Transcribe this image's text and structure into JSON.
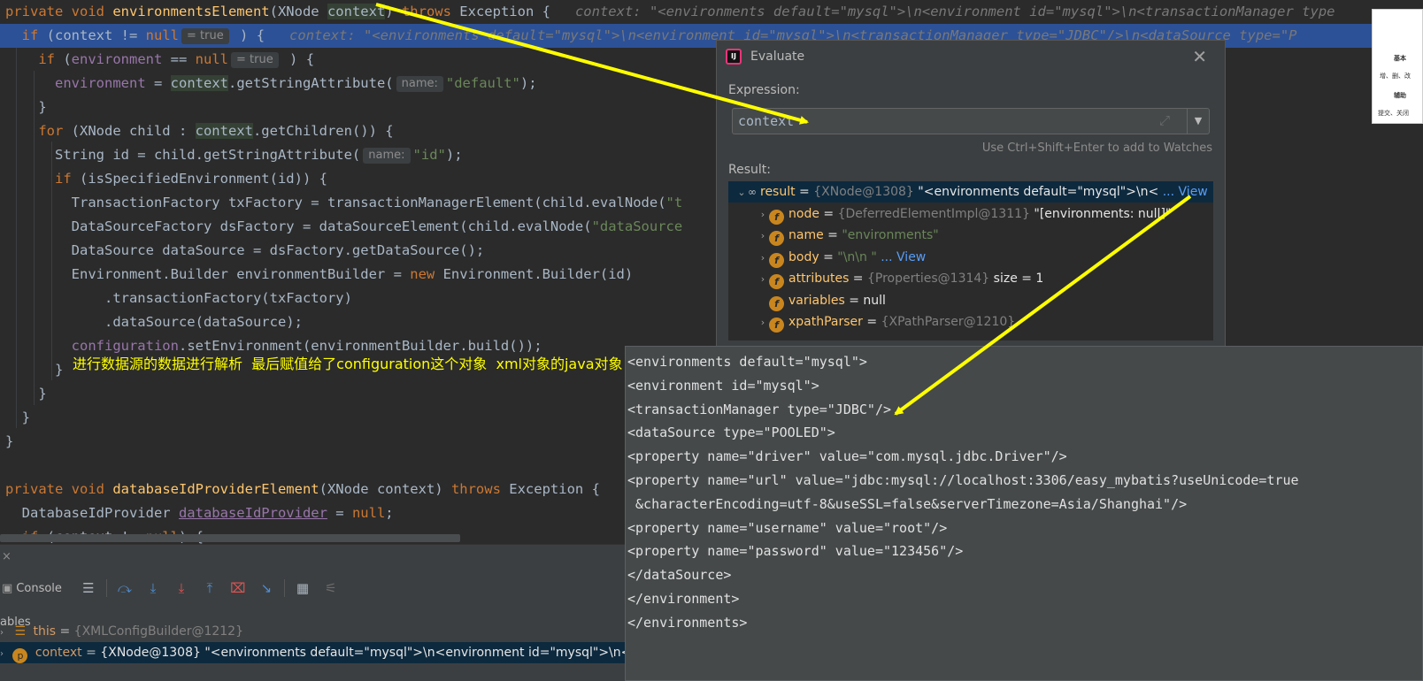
{
  "editor": {
    "lines": [
      {
        "segments": [
          [
            "kw",
            "private void "
          ],
          [
            "fn",
            "environmentsElement"
          ],
          [
            "",
            "(XNode "
          ],
          [
            "ctx",
            "context"
          ],
          [
            "",
            ") "
          ],
          [
            "kw",
            "throws "
          ],
          [
            "",
            "Exception {   "
          ],
          [
            "inline",
            "context: \"<environments default=\"mysql\">\\n<environment id=\"mysql\">\\n<transactionManager type"
          ]
        ]
      },
      {
        "segments": [
          [
            "",
            "  "
          ],
          [
            "kw",
            "if "
          ],
          [
            "",
            "(context != "
          ],
          [
            "kw",
            "null"
          ],
          [
            "hint",
            "= true"
          ],
          [
            "",
            " ) {   "
          ],
          [
            "inline",
            "context: \"<environments default=\"mysql\">\\n<environment id=\"mysql\">\\n<transactionManager type=\"JDBC\"/>\\n<dataSource type=\"P"
          ]
        ]
      },
      {
        "segments": [
          [
            "",
            "    "
          ],
          [
            "kw",
            "if "
          ],
          [
            "",
            "("
          ],
          [
            "fld",
            "environment"
          ],
          [
            "",
            " == "
          ],
          [
            "kw",
            "null"
          ],
          [
            "hint",
            "= true"
          ],
          [
            "",
            " ) {"
          ]
        ]
      },
      {
        "segments": [
          [
            "",
            "      "
          ],
          [
            "fld",
            "environment"
          ],
          [
            "",
            " = "
          ],
          [
            "ctx",
            "context"
          ],
          [
            "",
            ".getStringAttribute("
          ],
          [
            "hint",
            "name:"
          ],
          [
            "str",
            "\"default\""
          ],
          [
            "",
            ");"
          ]
        ]
      },
      {
        "segments": [
          [
            "",
            "    }"
          ]
        ]
      },
      {
        "segments": [
          [
            "",
            "    "
          ],
          [
            "kw",
            "for "
          ],
          [
            "",
            "(XNode child : "
          ],
          [
            "ctx",
            "context"
          ],
          [
            "",
            ".getChildren()) {"
          ]
        ]
      },
      {
        "segments": [
          [
            "",
            "      String id = child.getStringAttribute("
          ],
          [
            "hint",
            "name:"
          ],
          [
            "str",
            "\"id\""
          ],
          [
            "",
            ");"
          ]
        ]
      },
      {
        "segments": [
          [
            "",
            "      "
          ],
          [
            "kw",
            "if "
          ],
          [
            "",
            "(isSpecifiedEnvironment(id)) {"
          ]
        ]
      },
      {
        "segments": [
          [
            "",
            "        TransactionFactory txFactory = transactionManagerElement(child.evalNode("
          ],
          [
            "str",
            "\"t"
          ]
        ]
      },
      {
        "segments": [
          [
            "",
            "        DataSourceFactory dsFactory = dataSourceElement(child.evalNode("
          ],
          [
            "str",
            "\"dataSource"
          ]
        ]
      },
      {
        "segments": [
          [
            "",
            "        DataSource dataSource = dsFactory.getDataSource();"
          ]
        ]
      },
      {
        "segments": [
          [
            "",
            "        Environment.Builder environmentBuilder = "
          ],
          [
            "kw",
            "new "
          ],
          [
            "",
            "Environment.Builder(id)"
          ]
        ]
      },
      {
        "segments": [
          [
            "",
            "            .transactionFactory(txFactory)"
          ]
        ]
      },
      {
        "segments": [
          [
            "",
            "            .dataSource(dataSource);"
          ]
        ]
      },
      {
        "segments": [
          [
            "",
            "        "
          ],
          [
            "fld",
            "configuration"
          ],
          [
            "",
            ".setEnvironment(environmentBuilder.build());"
          ]
        ]
      },
      {
        "segments": [
          [
            "",
            "      }"
          ]
        ]
      },
      {
        "segments": [
          [
            "",
            "    }"
          ]
        ]
      },
      {
        "segments": [
          [
            "",
            "  }"
          ]
        ]
      },
      {
        "segments": [
          [
            "",
            "}"
          ]
        ]
      },
      {
        "segments": [
          [
            "",
            ""
          ]
        ]
      },
      {
        "segments": [
          [
            "kw",
            "private void "
          ],
          [
            "fn",
            "databaseIdProviderElement"
          ],
          [
            "",
            "(XNode context) "
          ],
          [
            "kw",
            "throws "
          ],
          [
            "",
            "Exception {"
          ]
        ]
      },
      {
        "segments": [
          [
            "",
            "  DatabaseIdProvider "
          ],
          [
            "ulfld",
            "databaseIdProvider"
          ],
          [
            "",
            " = "
          ],
          [
            "kw",
            "null"
          ],
          [
            "",
            ";"
          ]
        ]
      },
      {
        "segments": [
          [
            "",
            "  "
          ],
          [
            "kw",
            "if "
          ],
          [
            "",
            "(context != "
          ],
          [
            "kw",
            "null"
          ],
          [
            "",
            ") {"
          ]
        ]
      }
    ]
  },
  "annotation": "进行数据源的数据进行解析  最后赋值给了configuration这个对象  xml对象的java对象",
  "evaluate": {
    "title": "Evaluate",
    "expression_label": "Expression:",
    "expression_value": "context",
    "hint": "Use Ctrl+Shift+Enter to add to Watches",
    "result_label": "Result:",
    "tree": [
      {
        "arrow": "⌄",
        "icon": "glasses",
        "name": "result",
        "type": "{XNode@1308}",
        "value": "\"<environments default=\"mysql\">\\n<",
        "link": "... View",
        "selected": true
      },
      {
        "arrow": "›",
        "icon": "f",
        "name": "node",
        "type": "{DeferredElementImpl@1311}",
        "value": "\"[environments: null]\"",
        "link": ""
      },
      {
        "arrow": "›",
        "icon": "f",
        "name": "name",
        "type": "",
        "value": "\"environments\"",
        "link": ""
      },
      {
        "arrow": "›",
        "icon": "f",
        "name": "body",
        "type": "",
        "value": "\"\\n\\n       \"",
        "link": "... View"
      },
      {
        "arrow": "›",
        "icon": "f",
        "name": "attributes",
        "type": "{Properties@1314}",
        "value": "size = 1",
        "link": ""
      },
      {
        "arrow": "",
        "icon": "f",
        "name": "variables",
        "type": "",
        "value": "null",
        "link": ""
      },
      {
        "arrow": "›",
        "icon": "f",
        "name": "xpathParser",
        "type": "{XPathParser@1210}",
        "value": "",
        "link": ""
      }
    ]
  },
  "xml_popup": {
    "lines": [
      "<environments default=\"mysql\">",
      "<environment id=\"mysql\">",
      "<transactionManager type=\"JDBC\"/>",
      "<dataSource type=\"POOLED\">",
      "<property name=\"driver\" value=\"com.mysql.jdbc.Driver\"/>",
      "<property name=\"url\" value=\"jdbc:mysql://localhost:3306/easy_mybatis?useUnicode=true",
      " &characterEncoding=utf-8&useSSL=false&serverTimezone=Asia/Shanghai\"/>",
      "<property name=\"username\" value=\"root\"/>",
      "<property name=\"password\" value=\"123456\"/>",
      "</dataSource>",
      "</environment>",
      "</environments>"
    ]
  },
  "debug": {
    "close_label": "×",
    "console_label": "Console",
    "variables_label": "ables",
    "vars": [
      {
        "icon": "list",
        "name": "this",
        "value": "{XMLConfigBuilder@1212}"
      },
      {
        "icon": "p",
        "name": "context",
        "value": "{XNode@1308} \"<environments default=\"mysql\">\\n<environment id=\"mysql\">\\n<"
      }
    ]
  },
  "thumbnail": {
    "lines": [
      "基本",
      "增、删、改",
      "辅助",
      "提交、关闭"
    ]
  },
  "colors": {
    "annotation": "#ffff00",
    "highlight_line": "#2d5196",
    "keyword": "#cc7832",
    "function": "#ffc66d",
    "string": "#6a8759",
    "field": "#9876aa"
  }
}
